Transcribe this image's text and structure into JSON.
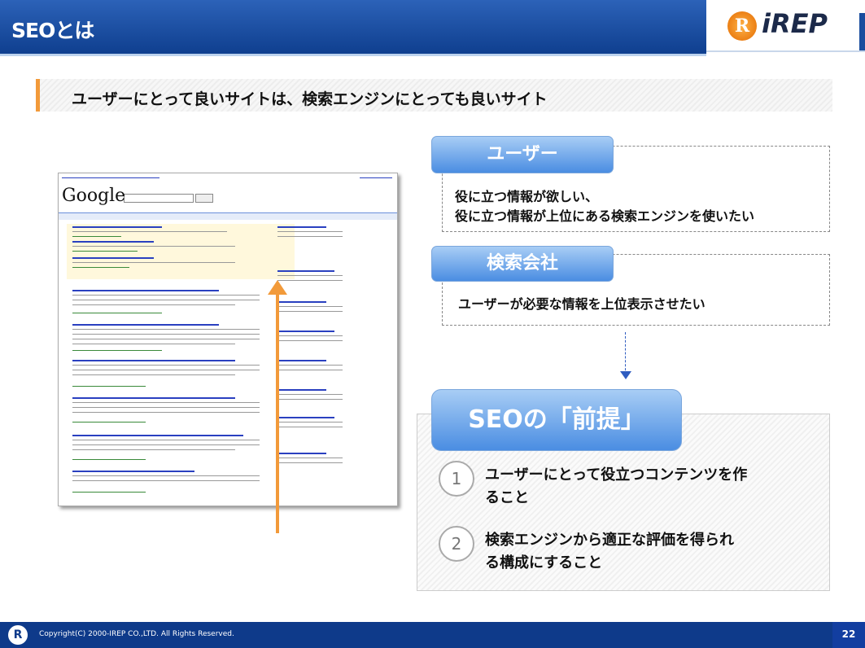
{
  "header": {
    "title": "SEOとは",
    "logo_text": "iREP",
    "logo_mark": "R"
  },
  "subtitle": "ユーザーにとって良いサイトは、検索エンジンにとっても良いサイト",
  "screenshot": {
    "google_logo": "Google"
  },
  "user_box": {
    "label": "ユーザー",
    "lines": [
      "役に立つ情報が欲しい、",
      "役に立つ情報が上位にある検索エンジンを使いたい"
    ]
  },
  "company_box": {
    "label": "検索会社",
    "text": "ユーザーが必要な情報を上位表示させたい"
  },
  "seo_box": {
    "label": "SEOの「前提」",
    "points": [
      {
        "num": "1",
        "lines": [
          "ユーザーにとって役立つコンテンツを作",
          "ること"
        ]
      },
      {
        "num": "2",
        "lines": [
          "検索エンジンから適正な評価を得られ",
          "る構成にすること"
        ]
      }
    ]
  },
  "footer": {
    "copyright": "Copyright(C) 2000-IREP CO.,LTD. All Rights Reserved.",
    "page": "22"
  },
  "colors": {
    "header_blue": "#1a4d9e",
    "accent_orange": "#f29a3a",
    "label_blue": "#4a8de2"
  }
}
